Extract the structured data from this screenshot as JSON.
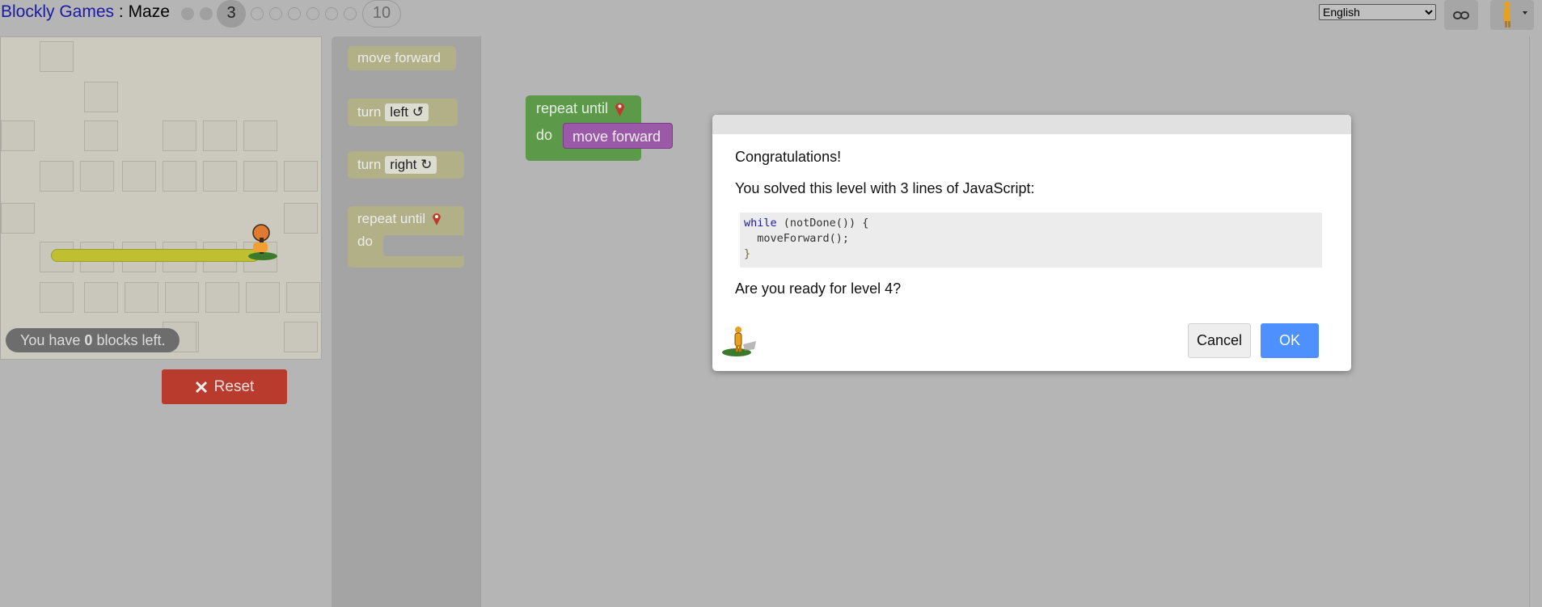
{
  "header": {
    "title_link": "Blockly Games",
    "title_sep": " : ",
    "title_game": "Maze",
    "current_level": "3",
    "last_level": "10",
    "language_options": [
      "English"
    ],
    "language_selected": "English"
  },
  "maze": {
    "blocks_left_prefix": "You have ",
    "blocks_left_count": "0",
    "blocks_left_suffix": " blocks left.",
    "reset_label": "Reset"
  },
  "toolbox": {
    "move_forward": "move forward",
    "turn_label": "turn",
    "turn_left_value": "left ↺",
    "turn_right_value": "right ↻",
    "repeat_label": "repeat until",
    "do_label": "do"
  },
  "workspace": {
    "repeat_label": "repeat until",
    "do_label": "do",
    "inner_block": "move forward"
  },
  "dialog": {
    "title": "Congratulations!",
    "solved_text": "You solved this level with 3 lines of JavaScript:",
    "code": {
      "line1_kw": "while",
      "line1_rest": " (notDone()) {",
      "line2": "  moveForward();",
      "line3": "}"
    },
    "question": "Are you ready for level 4?",
    "cancel_label": "Cancel",
    "ok_label": "OK"
  },
  "colors": {
    "reset": "#b83b2e",
    "ok_button": "#4d90fe",
    "loop_block": "#5c9a4a",
    "move_block": "#9b5aa7",
    "path": "#bfbf32"
  },
  "icons": [
    "link-icon",
    "pegman-icon",
    "reset-x-icon",
    "marker-icon",
    "goal-marker-icon"
  ]
}
